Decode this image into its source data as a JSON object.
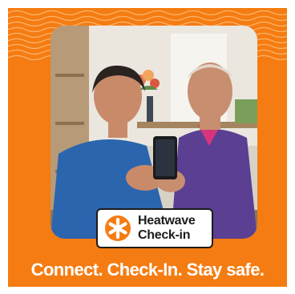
{
  "brand": {
    "colors": {
      "background": "#f57c12",
      "accent": "#f57c12",
      "text": "#ffffff",
      "badge_text": "#1c1c1c"
    }
  },
  "badge": {
    "icon": "asterisk-badge-icon",
    "title_line1": "Heatwave",
    "title_line2": "Check-in"
  },
  "photo": {
    "subject": "photo-two-seniors-looking-at-phone"
  },
  "tagline": "Connect. Check-In. Stay safe."
}
